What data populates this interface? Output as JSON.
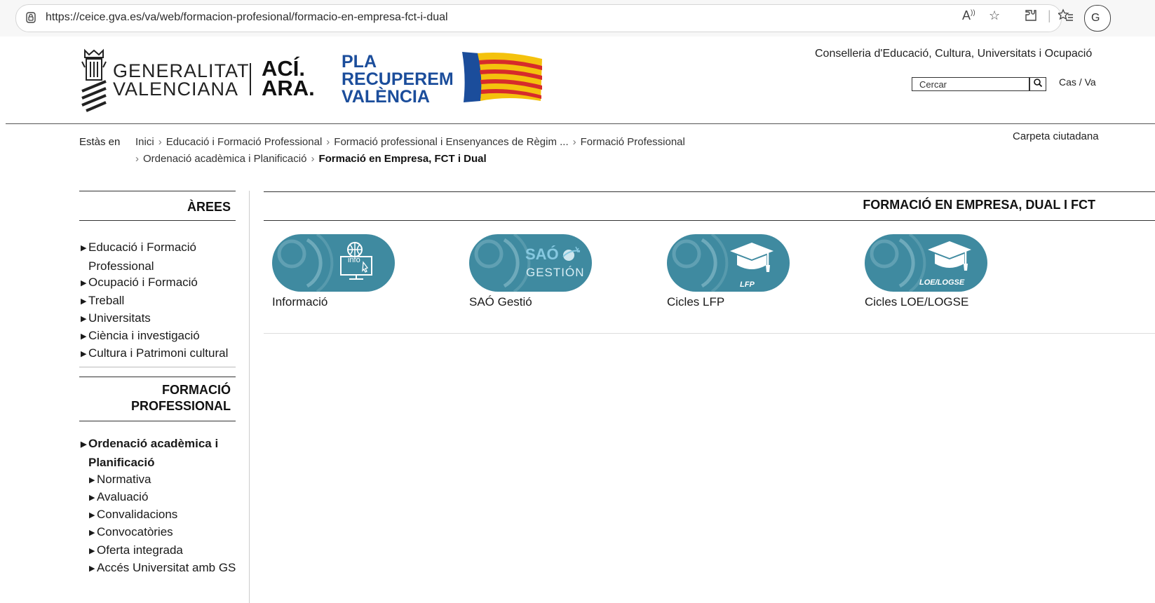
{
  "browser": {
    "url": "https://ceice.gva.es/va/web/formacion-profesional/formacio-en-empresa-fct-i-dual",
    "profile_initial": "G"
  },
  "header": {
    "gva_line1": "GENERALITAT",
    "gva_line2": "VALENCIANA",
    "aci_line1": "ACÍ.",
    "aci_line2": "ARA.",
    "pla_line1": "PLA",
    "pla_line2": "RECUPEREM",
    "pla_line3": "VALÈNCIA",
    "conselleria": "Conselleria d'Educació, Cultura, Universitats i Ocupació",
    "search_placeholder": "Cercar",
    "lang_cas": "Cas",
    "lang_sep": "/",
    "lang_va": "Va"
  },
  "breadcrumb": {
    "label": "Estàs en",
    "items": [
      "Inici",
      "Educació i Formació Professional",
      "Formació professional i Ensenyances de Règim ...",
      "Formació Professional",
      "Ordenació acadèmica i Planificació"
    ],
    "current": "Formació en Empresa, FCT i Dual",
    "separator": "›"
  },
  "carpeta": "Carpeta ciutadana",
  "sidebar": {
    "areas_heading": "ÀREES",
    "areas": [
      {
        "line1": "Educació i Formació",
        "line2": "Professional"
      },
      {
        "line1": "Ocupació i Formació"
      },
      {
        "line1": "Treball"
      },
      {
        "line1": "Universitats"
      },
      {
        "line1": "Ciència i investigació"
      },
      {
        "line1": "Cultura i Patrimoni cultural"
      }
    ],
    "fp_heading_line1": "FORMACIÓ",
    "fp_heading_line2": "PROFESSIONAL",
    "active_line1": "Ordenació acadèmica i",
    "active_line2": "Planificació",
    "subitems": [
      "Normativa",
      "Avaluació",
      "Convalidacions",
      "Convocatòries",
      "Oferta integrada",
      "Accés Universitat amb GS"
    ]
  },
  "main": {
    "title": "FORMACIÓ EN EMPRESA, DUAL I FCT",
    "tiles": [
      {
        "label": "Informació",
        "icon": "info-globe-monitor-icon",
        "icon_text": "info"
      },
      {
        "label": "SAÓ Gestió",
        "icon": "sao-gestion-logo",
        "icon_text1": "SAÓ",
        "icon_text2": "GESTIÓN"
      },
      {
        "label": "Cicles LFP",
        "icon": "graduation-cap-icon",
        "icon_text": "LFP"
      },
      {
        "label": "Cicles LOE/LOGSE",
        "icon": "graduation-cap-icon",
        "icon_text": "LOE/LOGSE"
      }
    ]
  },
  "colors": {
    "tile_bg": "#3f8aa0",
    "pla_blue": "#1b4d9b"
  }
}
